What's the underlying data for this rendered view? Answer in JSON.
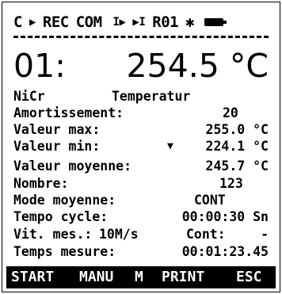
{
  "status_bar": {
    "channel": "C",
    "play_symbol": "▶",
    "rec": "REC",
    "com": "COM",
    "step_symbol": "I▶",
    "skip_symbol": "▶I",
    "range": "R01",
    "star": "✱"
  },
  "reading": {
    "channel": "01:",
    "value": "254.5 °C"
  },
  "sensor": {
    "type": "NiCr",
    "quantity": "Temperatur"
  },
  "rows": [
    {
      "label": "Amortissement:",
      "value": "20"
    },
    {
      "label": "Valeur max:",
      "value": "255.0 °C"
    },
    {
      "label": "Valeur min:",
      "marker": "▼",
      "value": "224.1 °C"
    },
    {
      "label": "Valeur moyenne:",
      "value": "245.7 °C"
    },
    {
      "label": "Nombre:",
      "value": "123"
    },
    {
      "label": "Mode moyenne:",
      "value": "CONT"
    },
    {
      "label": "Tempo cycle:",
      "value": "00:00:30 Sn"
    },
    {
      "label": "Vit. mes.:",
      "middle": "10M/s",
      "cont_label": "Cont:",
      "value": "-"
    },
    {
      "label": "Temps mesure:",
      "value": "00:01:23.45"
    }
  ],
  "softkeys": [
    "START",
    "MANU",
    "M",
    "PRINT",
    "ESC"
  ]
}
